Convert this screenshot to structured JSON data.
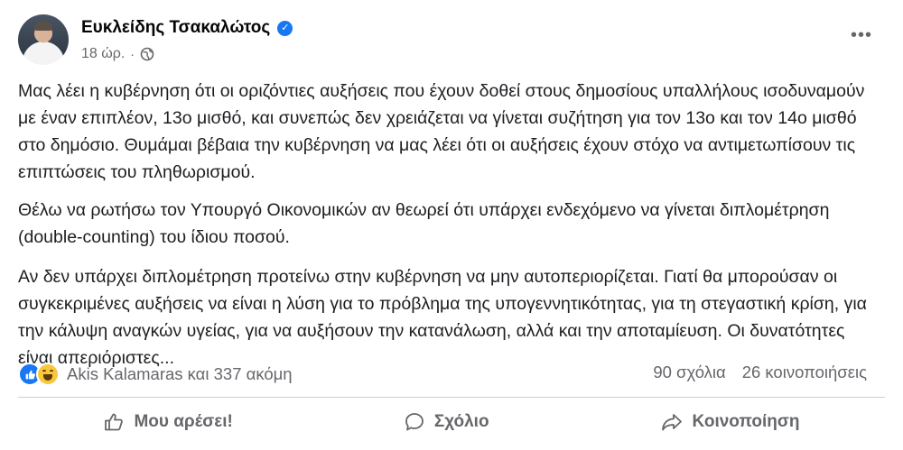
{
  "post": {
    "author": "Ευκλείδης Τσακαλώτος",
    "time": "18 ώρ.",
    "separator": "·",
    "paragraphs": [
      "Μας λέει η κυβέρνηση ότι οι οριζόντιες αυξήσεις που έχουν δοθεί στους δημοσίους υπαλλήλους ισοδυναμούν με έναν επιπλέον, 13ο μισθό, και συνεπώς δεν χρειάζεται να γίνεται συζήτηση για τον 13ο και τον 14ο μισθό στο δημόσιο. Θυμάμαι βέβαια την κυβέρνηση να μας λέει ότι οι αυξήσεις έχουν στόχο να αντιμετωπίσουν τις επιπτώσεις του πληθωρισμού.",
      "Θέλω να ρωτήσω τον Υπουργό Οικονομικών αν θεωρεί ότι υπάρχει ενδεχόμενο να γίνεται διπλομέτρηση (double-counting) του ίδιου ποσού.",
      "Αν δεν υπάρχει διπλομέτρηση προτείνω στην κυβέρνηση να μην αυτοπεριορίζεται. Γιατί θα μπορούσαν οι συγκεκριμένες αυξήσεις να είναι η λύση για το πρόβλημα της υπογεννητικότητας, για τη στεγαστική κρίση, για την κάλυψη αναγκών υγείας, για να αυξήσουν την κατανάλωση, αλλά και την αποταμίευση. Οι δυνατότητες είναι απεριόριστες..."
    ]
  },
  "stats": {
    "reactions_text": "Akis Kalamaras και 337 ακόμη",
    "comments": "90 σχόλια",
    "shares": "26 κοινοποιήσεις"
  },
  "actions": {
    "like": "Μου αρέσει!",
    "comment": "Σχόλιο",
    "share": "Κοινοποίηση"
  },
  "colors": {
    "accent": "#1877f2",
    "secondary_text": "#65676b",
    "haha": "#f7c83a"
  },
  "icons": [
    "verified-icon",
    "globe-icon",
    "more-icon",
    "like-reaction-icon",
    "haha-reaction-icon",
    "thumbs-up-icon",
    "comment-icon",
    "share-icon"
  ]
}
